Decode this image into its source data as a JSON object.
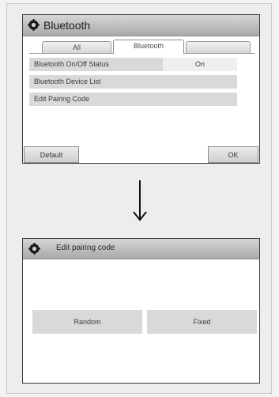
{
  "screen1": {
    "title": "Bluetooth",
    "tabs": [
      {
        "label": "All",
        "active": false
      },
      {
        "label": "Bluetooth",
        "active": true
      },
      {
        "label": "",
        "active": false
      }
    ],
    "rows": [
      {
        "label": "Bluetooth On/Off Status",
        "value": "On"
      },
      {
        "label": "Bluetooth Device List"
      },
      {
        "label": "Edit Pairing Code"
      }
    ],
    "buttons": {
      "default": "Default",
      "ok": "OK"
    }
  },
  "screen2": {
    "title": "Edit pairing code",
    "options": {
      "random": "Random",
      "fixed": "Fixed"
    }
  },
  "arrow_icon": "down-arrow",
  "colors": {
    "titlebar": "#a9a9a9",
    "row": "#d9d9d9",
    "border": "#3c3c3c"
  }
}
